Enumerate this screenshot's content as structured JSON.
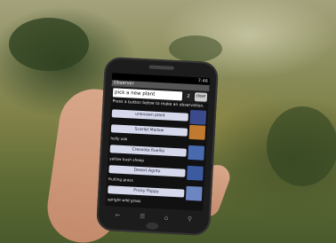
{
  "phone": {
    "status_time": "7:46",
    "app_title": "Observer",
    "entry_value": "pick a new plant",
    "count": "2",
    "clear_label": "clear",
    "prompt": "Press a button below to make an observation.",
    "observations": [
      {
        "button": "unknown plant",
        "label": "",
        "thumb": "#3a4a8a"
      },
      {
        "button": "Scarlet Mallow",
        "label": "holly oak",
        "thumb": "#c07a30"
      },
      {
        "button": "Creosote Ruellia",
        "label": "yellow bush sheep",
        "thumb": "#4a6ab0"
      },
      {
        "button": "Desert Agrito",
        "label": "fruiting grass",
        "thumb": "#3c5aa0"
      },
      {
        "button": "Pricky Poppy",
        "label": "upright wild grass",
        "thumb": "#6c86c2"
      }
    ]
  }
}
